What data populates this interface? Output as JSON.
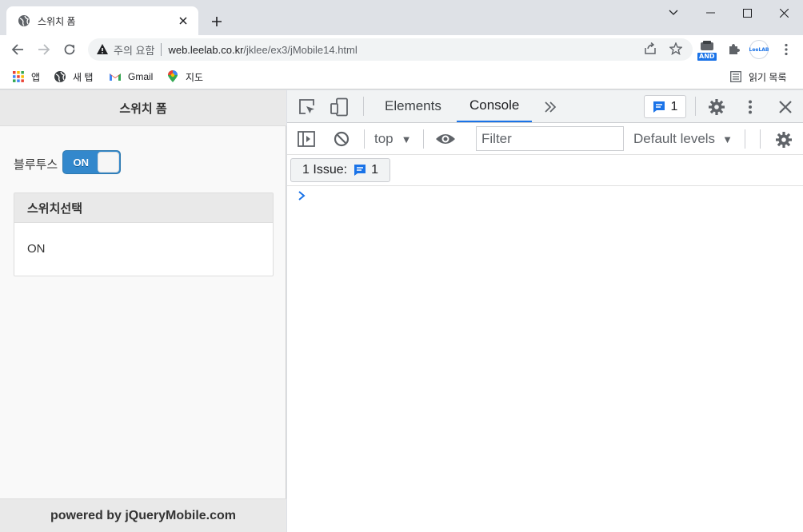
{
  "browser": {
    "tab": {
      "title": "스위치 폼",
      "favicon": "globe-icon"
    },
    "omnibox": {
      "security_label": "주의 요함",
      "url_host": "web.leelab.co.kr",
      "url_path": "/jklee/ex3/jMobile14.html"
    },
    "extensions": {
      "and_badge": "AND",
      "leelab_label": "LeeLAB"
    },
    "bookmarks": [
      {
        "label": "앱",
        "icon": "apps-grid-icon"
      },
      {
        "label": "새 탭",
        "icon": "globe-icon"
      },
      {
        "label": "Gmail",
        "icon": "gmail-icon"
      },
      {
        "label": "지도",
        "icon": "maps-pin-icon"
      }
    ],
    "reading_list": "읽기 목록"
  },
  "page": {
    "header_title": "스위치 폼",
    "field_label": "블루투스",
    "switch": {
      "on_label": "ON",
      "state": "on"
    },
    "collapsible": {
      "title": "스위치선택",
      "content": "ON"
    },
    "footer": "powered by jQueryMobile.com"
  },
  "devtools": {
    "tabs": [
      "Elements",
      "Console"
    ],
    "active_tab": "Console",
    "issues_count": "1",
    "context": "top",
    "filter_placeholder": "Filter",
    "levels": "Default levels",
    "issues_bar_label": "1 Issue:",
    "issues_bar_count": "1"
  },
  "colors": {
    "accent": "#1a73e8",
    "switch_on": "#3388cc",
    "chrome_frame": "#dee1e6"
  }
}
